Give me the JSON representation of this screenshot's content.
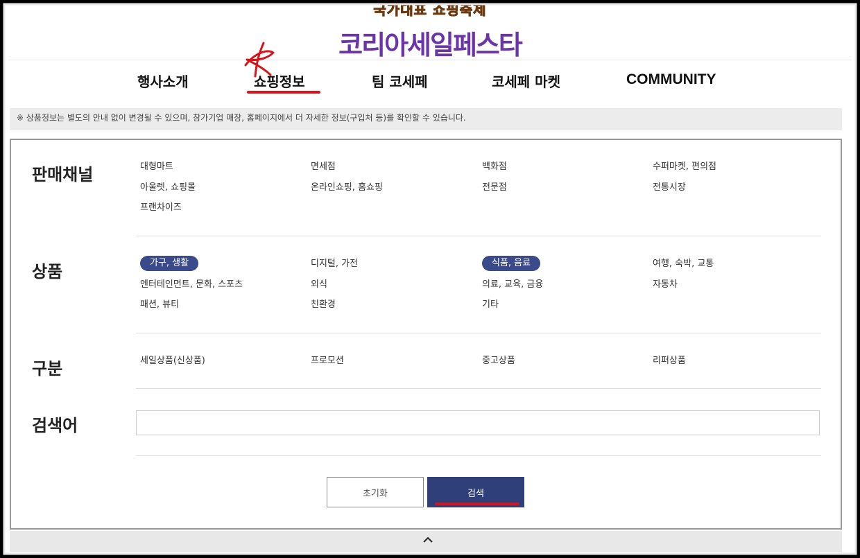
{
  "header": {
    "tagline": "국가대표 쇼핑축제",
    "brand": "코리아세일페스타"
  },
  "nav": {
    "items": [
      "행사소개",
      "쇼핑정보",
      "팀 코세페",
      "코세페 마켓",
      "COMMUNITY"
    ],
    "active": "쇼핑정보"
  },
  "notice": "※ 상품정보는 별도의 안내 없이 변경될 수 있으며, 참가기업 매장, 홈페이지에서 더 자세한 정보(구입처 등)를 확인할 수 있습니다.",
  "filters": {
    "channel": {
      "label": "판매채널",
      "options": [
        "대형마트",
        "면세점",
        "백화점",
        "수퍼마켓, 편의점",
        "아울렛, 쇼핑몰",
        "온라인쇼핑, 홈쇼핑",
        "전문점",
        "전통시장",
        "프랜차이즈"
      ]
    },
    "product": {
      "label": "상품",
      "options": [
        "가구, 생활",
        "디지털, 가전",
        "식품, 음료",
        "여행, 숙박, 교통",
        "엔터테인먼트, 문화, 스포츠",
        "외식",
        "의료, 교육, 금융",
        "자동차",
        "패션, 뷰티",
        "친환경",
        "기타"
      ],
      "selected": [
        "가구, 생활",
        "식품, 음료"
      ]
    },
    "type": {
      "label": "구분",
      "options": [
        "세일상품(신상품)",
        "프로모션",
        "중고상품",
        "리퍼상품"
      ]
    },
    "keyword": {
      "label": "검색어",
      "value": "",
      "placeholder": ""
    }
  },
  "buttons": {
    "reset": "초기화",
    "search": "검색"
  },
  "colors": {
    "accent": "#2f3f7a",
    "selected_chip": "#3a4a8a",
    "annotation": "#d7141a"
  },
  "icons": {
    "scroll_top": "chevron-up-icon"
  }
}
